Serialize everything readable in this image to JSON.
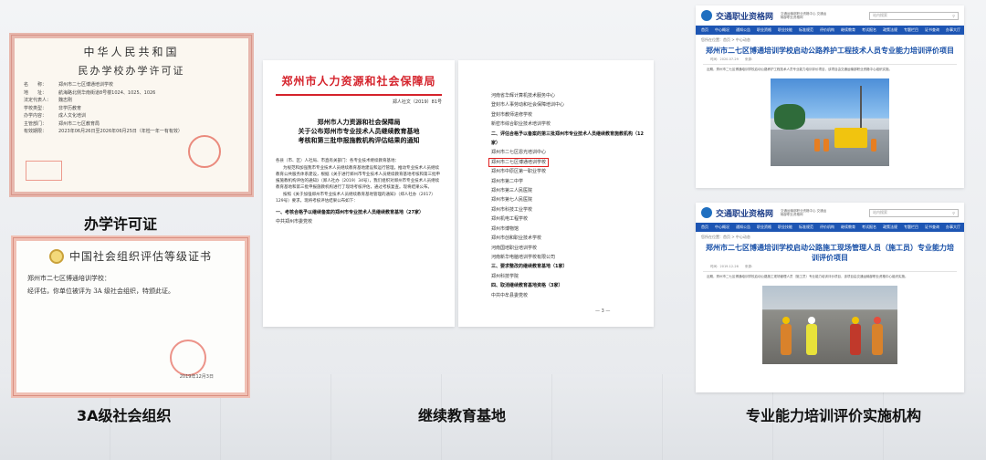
{
  "captions": {
    "permit": "办学许可证",
    "social_org": "3A级社会组织",
    "base": "继续教育基地",
    "institution": "专业能力培训评价实施机构"
  },
  "permit": {
    "title1": "中华人民共和国",
    "title2": "民办学校办学许可证",
    "rows": [
      {
        "k": "名　　称：",
        "v": "郑州市二七区博通培训学校"
      },
      {
        "k": "地　　址：",
        "v": "航海路北侧华南街道8号楼1024、1025、1026"
      },
      {
        "k": "法定代表人：",
        "v": "魏志刚"
      },
      {
        "k": "学校类型：",
        "v": "非学历教育"
      },
      {
        "k": "办学内容：",
        "v": "成人文化培训"
      },
      {
        "k": "主管部门：",
        "v": "郑州市二七区教育局"
      },
      {
        "k": "有效期限：",
        "v": "2023年06月26日至2026年06月25日（年检一年一有有效）"
      }
    ]
  },
  "cert3a": {
    "title": "中国社会组织评估等级证书",
    "line1": "郑州市二七区博通培训学校：",
    "line2": "经评估，你单位被评为 3A 级社会组织，特颁此证。",
    "date": "2019年12月3日"
  },
  "notice": {
    "org": "郑州市人力资源和社会保障局",
    "doc_no": "郑人社文（2019）81号",
    "title_lines": [
      "郑州市人力资源和社会保障局",
      "关于公布郑州市专业技术人员继续教育基地",
      "考核和第三批申报施教机构评估结果的通知"
    ],
    "body": [
      "各县（市、区）人社局、市直有关部门：各专业技术继续教育基地：",
      "为规范和加强我市专业技术人员继续教育基地建设和运行管理，推动专业技术人员继续教育公共服务体系建设，根据《关于进行郑州市专业技术人员继续教育基地考核和第三批申报施教机构评估的通知》（郑人社办（2019）34号），我们组织对郑州市专业技术人员继续教育基地和第三批申报施教机构进行了现场考核评估，通过考核复查。现将结果公布。",
      "按照《关于加强郑州市专业技术人员继续教育基地管理的通知》（郑人社办（2017）129号）要求，现将考核评估结果公布如下："
    ],
    "section": "一、考核合格予以继续备案的郑州市专业技术人员继续教育基地（27家）",
    "item": "中共郑州市委党校"
  },
  "listdoc": {
    "items": [
      {
        "text": "河南省华辉计算机技术服务中心",
        "type": "normal"
      },
      {
        "text": "登封市人事劳动和社会保障培训中心",
        "type": "normal"
      },
      {
        "text": "登封市教师进修学校",
        "type": "normal"
      },
      {
        "text": "新密市综合职业技术培训学校",
        "type": "normal"
      },
      {
        "text": "二、评估合格予以备案的第三批郑州市专业技术人员继续教育施教机构（12家）",
        "type": "header"
      },
      {
        "text": "郑州市二七区恩光培训中心",
        "type": "normal"
      },
      {
        "text": "郑州市二七区博通培训学校",
        "type": "highlight"
      },
      {
        "text": "郑州市中原区第一职业学校",
        "type": "normal"
      },
      {
        "text": "郑州市第二中学",
        "type": "normal"
      },
      {
        "text": "郑州市第三人民医院",
        "type": "normal"
      },
      {
        "text": "郑州市第七人民医院",
        "type": "normal"
      },
      {
        "text": "郑州市科技工业学校",
        "type": "normal"
      },
      {
        "text": "郑州机电工程学校",
        "type": "normal"
      },
      {
        "text": "郑州市博物馆",
        "type": "normal"
      },
      {
        "text": "郑州市创和职业技术学校",
        "type": "normal"
      },
      {
        "text": "河南国培职业培训学校",
        "type": "normal"
      },
      {
        "text": "河南新华电脑培训学校有限公司",
        "type": "normal"
      },
      {
        "text": "三、要求整改的继续教育基地（1家）",
        "type": "header"
      },
      {
        "text": "郑州科技学院",
        "type": "normal"
      },
      {
        "text": "四、取消继续教育基地资格（3家）",
        "type": "header"
      },
      {
        "text": "中共中牟县委党校",
        "type": "normal"
      }
    ],
    "page": "— 3 —"
  },
  "web1": {
    "brand": "交通职业资格网",
    "tagline": "交通运输部职业资格中心 交通运输部职业资格网",
    "search_placeholder": "站内搜索",
    "nav": [
      "首页",
      "中心概况",
      "通知公告",
      "职业资格",
      "职业技能",
      "标准规范",
      "评价机构",
      "继续教育",
      "考试报名",
      "政策法规",
      "专题栏目",
      "证书查询",
      "办事大厅"
    ],
    "crumb": "您所在位置：首页 > 中心动态",
    "title": "郑州市二七区博通培训学校启动公路养护工程技术人员专业能力培训评价项目",
    "meta": "时间：2020-07-29　　来源：",
    "para": "近期，郑州市二七区博通培训学校启动公路养护工程技术人员专业能力培训评价项目，该项目由交通运输部职业资格中心组织实施。"
  },
  "web2": {
    "brand": "交通职业资格网",
    "tagline": "交通运输部职业资格中心 交通运输部职业资格网",
    "search_placeholder": "站内搜索",
    "nav": [
      "首页",
      "中心概况",
      "通知公告",
      "职业资格",
      "职业技能",
      "标准规范",
      "评价机构",
      "继续教育",
      "考试报名",
      "政策法规",
      "专题栏目",
      "证书查询",
      "办事大厅"
    ],
    "crumb": "您所在位置：首页 > 中心动态",
    "title": "郑州市二七区博通培训学校启动公路施工现场管理人员（施工员）专业能力培训评价项目",
    "meta": "时间：2019-12-26　　来源：",
    "para": "近期，郑州市二七区博通培训学校启动公路施工现场管理人员（施工员）专业能力培训评价项目，该项目由交通运输部职业资格中心组织实施。"
  }
}
